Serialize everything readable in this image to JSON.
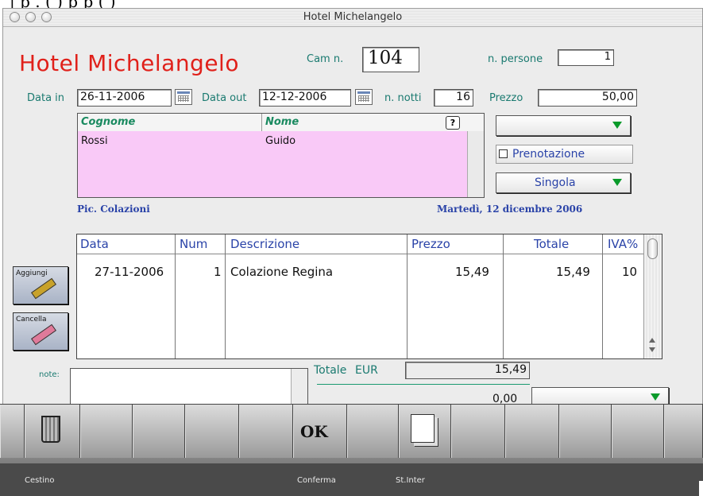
{
  "window": {
    "title": "Hotel Michelangelo"
  },
  "clipped_text": "|     p    .     ( )      p   p  ( )",
  "header": {
    "hotel_name": "Hotel Michelangelo",
    "room_label": "Cam n.",
    "room_value": "104",
    "persons_label": "n. persone",
    "persons_value": "1"
  },
  "dates": {
    "in_label": "Data in",
    "in_value": "26-11-2006",
    "out_label": "Data out",
    "out_value": "12-12-2006",
    "nights_label": "n. notti",
    "nights_value": "16",
    "price_label": "Prezzo",
    "price_value": "50,00"
  },
  "guest": {
    "col_surname": "Cognome",
    "col_name": "Nome",
    "help": "?",
    "surname": "Rossi",
    "name": "Guido"
  },
  "right_panel": {
    "select1_value": "",
    "reservation_label": "Prenotazione",
    "reservation_checked": false,
    "room_type": "Singola"
  },
  "info": {
    "left": "Pic. Colazioni",
    "date": "Martedì, 12 dicembre 2006"
  },
  "table": {
    "headers": {
      "date": "Data",
      "num": "Num",
      "desc": "Descrizione",
      "price": "Prezzo",
      "total": "Totale",
      "vat": "IVA%"
    },
    "rows": [
      {
        "date": "27-11-2006",
        "num": "1",
        "desc": "Colazione Regina",
        "price": "15,49",
        "total": "15,49",
        "vat": "10"
      }
    ]
  },
  "buttons": {
    "add": "Aggiungi",
    "delete": "Cancella"
  },
  "notes": {
    "label": "note:",
    "value": ""
  },
  "totals": {
    "label": "Totale",
    "currency": "EUR",
    "value": "15,49",
    "second_value": "0,00",
    "select_value": ""
  },
  "toolbar": {
    "trash": "Cestino",
    "confirm": "Conferma",
    "print": "St.Inter",
    "ok_glyph": "OK"
  },
  "colors": {
    "accent_red": "#e0201a",
    "label_teal": "#1a7a70",
    "label_blue": "#2a43a8",
    "guest_pink": "#f9c9f7",
    "popup_green": "#0a9a2a"
  }
}
